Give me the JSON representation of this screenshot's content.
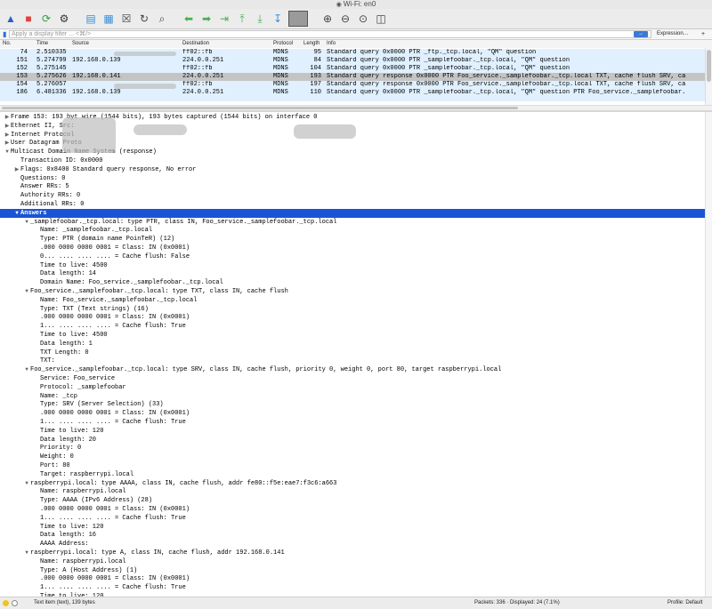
{
  "window": {
    "title": "Wi-Fi: en0"
  },
  "toolbar": {
    "icons": [
      "shark-fin-start-icon",
      "stop-capture-icon",
      "restart-capture-icon",
      "capture-options-icon",
      "open-file-icon",
      "save-file-icon",
      "close-file-icon",
      "reload-file-icon",
      "find-packet-icon",
      "go-back-icon",
      "go-forward-icon",
      "go-to-packet-icon",
      "first-packet-icon",
      "last-packet-icon",
      "auto-scroll-icon",
      "colorize-icon",
      "zoom-in-icon",
      "zoom-out-icon",
      "zoom-normal-icon",
      "resize-columns-icon"
    ]
  },
  "filter": {
    "placeholder": "Apply a display filter ... <⌘/>",
    "expression_label": "Expression…",
    "plus_label": "+"
  },
  "columns": {
    "no": "No.",
    "time": "Time",
    "source": "Source",
    "destination": "Destination",
    "protocol": "Protocol",
    "length": "Length",
    "info": "Info"
  },
  "packets": [
    {
      "no": "74",
      "time": "2.510335",
      "source": "",
      "destination": "ff02::fb",
      "protocol": "MDNS",
      "length": "95",
      "info": "Standard query 0x0000 PTR _ftp._tcp.local, \"QM\" question"
    },
    {
      "no": "151",
      "time": "5.274799",
      "source": "192.168.0.139",
      "destination": "224.0.0.251",
      "protocol": "MDNS",
      "length": "84",
      "info": "Standard query 0x0000 PTR _samplefoobar._tcp.local, \"QM\" question"
    },
    {
      "no": "152",
      "time": "5.275145",
      "source": "",
      "destination": "ff02::fb",
      "protocol": "MDNS",
      "length": "104",
      "info": "Standard query 0x0000 PTR _samplefoobar._tcp.local, \"QM\" question"
    },
    {
      "no": "153",
      "time": "5.275626",
      "source": "192.168.0.141",
      "destination": "224.0.0.251",
      "protocol": "MDNS",
      "length": "193",
      "info": "Standard query response 0x0000 PTR Foo_service._samplefoobar._tcp.local TXT, cache flush SRV, ca"
    },
    {
      "no": "154",
      "time": "5.276057",
      "source": "",
      "destination": "ff02::fb",
      "protocol": "MDNS",
      "length": "197",
      "info": "Standard query response 0x0000 PTR Foo_service._samplefoobar._tcp.local TXT, cache flush SRV, ca"
    },
    {
      "no": "186",
      "time": "6.481336",
      "source": "192.168.0.139",
      "destination": "224.0.0.251",
      "protocol": "MDNS",
      "length": "110",
      "info": "Standard query 0x0000 PTR _samplefoobar._tcp.local, \"QM\" question PTR Foo_service._samplefoobar."
    }
  ],
  "details": [
    {
      "t": "▶",
      "i": 0,
      "text": "Frame 153: 193 byt     wire (1544 bits), 193 bytes captured (1544 bits) on interface 0"
    },
    {
      "t": "▶",
      "i": 0,
      "text": "Ethernet II, Src:"
    },
    {
      "t": "▶",
      "i": 0,
      "text": "Internet Protocol"
    },
    {
      "t": "▶",
      "i": 0,
      "text": "User Datagram Proto"
    },
    {
      "t": "▼",
      "i": 0,
      "text": "Multicast Domain Name System (response)"
    },
    {
      "t": "",
      "i": 1,
      "text": "Transaction ID: 0x0000"
    },
    {
      "t": "▶",
      "i": 1,
      "text": "Flags: 0x8400 Standard query response, No error"
    },
    {
      "t": "",
      "i": 1,
      "text": "Questions: 0"
    },
    {
      "t": "",
      "i": 1,
      "text": "Answer RRs: 5"
    },
    {
      "t": "",
      "i": 1,
      "text": "Authority RRs: 0"
    },
    {
      "t": "",
      "i": 1,
      "text": "Additional RRs: 0"
    },
    {
      "t": "▼",
      "i": 1,
      "text": "Answers"
    },
    {
      "t": "▼",
      "i": 2,
      "text": "_samplefoobar._tcp.local: type PTR, class IN, Foo_service._samplefoobar._tcp.local"
    },
    {
      "t": "",
      "i": 3,
      "text": "Name: _samplefoobar._tcp.local"
    },
    {
      "t": "",
      "i": 3,
      "text": "Type: PTR (domain name PoinTeR) (12)"
    },
    {
      "t": "",
      "i": 3,
      "text": ".000 0000 0000 0001 = Class: IN (0x0001)"
    },
    {
      "t": "",
      "i": 3,
      "text": "0... .... .... .... = Cache flush: False"
    },
    {
      "t": "",
      "i": 3,
      "text": "Time to live: 4500"
    },
    {
      "t": "",
      "i": 3,
      "text": "Data length: 14"
    },
    {
      "t": "",
      "i": 3,
      "text": "Domain Name: Foo_service._samplefoobar._tcp.local"
    },
    {
      "t": "▼",
      "i": 2,
      "text": "Foo_service._samplefoobar._tcp.local: type TXT, class IN, cache flush"
    },
    {
      "t": "",
      "i": 3,
      "text": "Name: Foo_service._samplefoobar._tcp.local"
    },
    {
      "t": "",
      "i": 3,
      "text": "Type: TXT (Text strings) (16)"
    },
    {
      "t": "",
      "i": 3,
      "text": ".000 0000 0000 0001 = Class: IN (0x0001)"
    },
    {
      "t": "",
      "i": 3,
      "text": "1... .... .... .... = Cache flush: True"
    },
    {
      "t": "",
      "i": 3,
      "text": "Time to live: 4500"
    },
    {
      "t": "",
      "i": 3,
      "text": "Data length: 1"
    },
    {
      "t": "",
      "i": 3,
      "text": "TXT Length: 0"
    },
    {
      "t": "",
      "i": 3,
      "text": "TXT:"
    },
    {
      "t": "▼",
      "i": 2,
      "text": "Foo_service._samplefoobar._tcp.local: type SRV, class IN, cache flush, priority 0, weight 0, port 80, target raspberrypi.local"
    },
    {
      "t": "",
      "i": 3,
      "text": "Service: Foo_service"
    },
    {
      "t": "",
      "i": 3,
      "text": "Protocol: _samplefoobar"
    },
    {
      "t": "",
      "i": 3,
      "text": "Name: _tcp"
    },
    {
      "t": "",
      "i": 3,
      "text": "Type: SRV (Server Selection) (33)"
    },
    {
      "t": "",
      "i": 3,
      "text": ".000 0000 0000 0001 = Class: IN (0x0001)"
    },
    {
      "t": "",
      "i": 3,
      "text": "1... .... .... .... = Cache flush: True"
    },
    {
      "t": "",
      "i": 3,
      "text": "Time to live: 120"
    },
    {
      "t": "",
      "i": 3,
      "text": "Data length: 20"
    },
    {
      "t": "",
      "i": 3,
      "text": "Priority: 0"
    },
    {
      "t": "",
      "i": 3,
      "text": "Weight: 0"
    },
    {
      "t": "",
      "i": 3,
      "text": "Port: 80"
    },
    {
      "t": "",
      "i": 3,
      "text": "Target: raspberrypi.local"
    },
    {
      "t": "▼",
      "i": 2,
      "text": "raspberrypi.local: type AAAA, class IN, cache flush, addr fe80::f5e:eae7:f3c6:a663"
    },
    {
      "t": "",
      "i": 3,
      "text": "Name: raspberrypi.local"
    },
    {
      "t": "",
      "i": 3,
      "text": "Type: AAAA (IPv6 Address) (28)"
    },
    {
      "t": "",
      "i": 3,
      "text": ".000 0000 0000 0001 = Class: IN (0x0001)"
    },
    {
      "t": "",
      "i": 3,
      "text": "1... .... .... .... = Cache flush: True"
    },
    {
      "t": "",
      "i": 3,
      "text": "Time to live: 120"
    },
    {
      "t": "",
      "i": 3,
      "text": "Data length: 16"
    },
    {
      "t": "",
      "i": 3,
      "text": "AAAA Address:"
    },
    {
      "t": "▼",
      "i": 2,
      "text": "raspberrypi.local: type A, class IN, cache flush, addr 192.168.0.141"
    },
    {
      "t": "",
      "i": 3,
      "text": "Name: raspberrypi.local"
    },
    {
      "t": "",
      "i": 3,
      "text": "Type: A (Host Address) (1)"
    },
    {
      "t": "",
      "i": 3,
      "text": ".000 0000 0000 0001 = Class: IN (0x0001)"
    },
    {
      "t": "",
      "i": 3,
      "text": "1... .... .... .... = Cache flush: True"
    },
    {
      "t": "",
      "i": 3,
      "text": "Time to live: 120"
    }
  ],
  "selection": {
    "packet_no": "153",
    "detail_text": "Answers"
  },
  "status": {
    "item": "Text item (text), 139 bytes",
    "packets": "Packets: 336 · Displayed: 24 (7.1%)",
    "profile": "Profile: Default"
  },
  "colors": {
    "accent": "#1a54d6",
    "row_bg": "#e0f0ff",
    "selected_row": "#c4c4c4"
  }
}
